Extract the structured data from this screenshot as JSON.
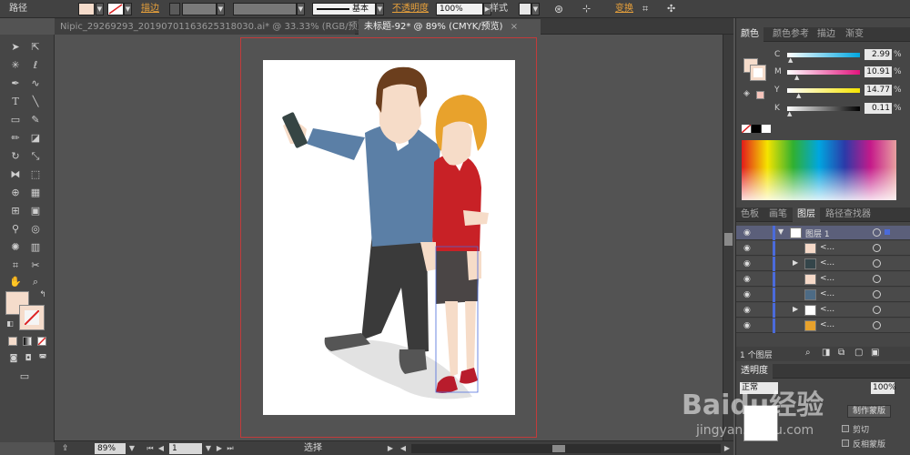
{
  "control_bar": {
    "object_type": "路径",
    "stroke_label": "描边",
    "stroke_style": "基本",
    "opacity_label": "不透明度",
    "opacity_value": "100%",
    "style_label": "样式",
    "transform_label": "变换"
  },
  "tabs": [
    {
      "label": "Nipic_29269293_20190701163625318030.ai* @ 33.33% (RGB/预览)",
      "active": false
    },
    {
      "label": "未标题-92* @ 89% (CMYK/预览)",
      "active": true
    }
  ],
  "tab_close": "×",
  "status": {
    "zoom": "89%",
    "artboard": "1",
    "tool": "选择"
  },
  "color_panel": {
    "tabs": [
      "颜色",
      "颜色参考",
      "描边",
      "渐变"
    ],
    "sliders": [
      {
        "label": "C",
        "value": "2.99",
        "unit": "%",
        "pos": 0.03
      },
      {
        "label": "M",
        "value": "10.91",
        "unit": "%",
        "pos": 0.11
      },
      {
        "label": "Y",
        "value": "14.77",
        "unit": "%",
        "pos": 0.15
      },
      {
        "label": "K",
        "value": "0.11",
        "unit": "%",
        "pos": 0.01
      }
    ]
  },
  "layers_panel": {
    "tabs": [
      "色板",
      "画笔",
      "图层",
      "路径查找器"
    ],
    "layer_name": "图层 1",
    "sublayer_label": "<...",
    "count_label": "1 个图层"
  },
  "transparency_panel": {
    "tab": "透明度",
    "blend_mode": "正常",
    "opacity": "100%",
    "make_mask": "制作蒙版",
    "clip_label": "剪切",
    "invert_label": "反相蒙版"
  },
  "watermark": {
    "text1": "Baidu经验",
    "text2": "jingyan.baidu.com"
  },
  "colors": {
    "fill": "#f5dccb",
    "skin": "#f6dcc8",
    "man_hair": "#6b3e1d",
    "man_sweater": "#5b7fa6",
    "man_pants": "#3a3a3a",
    "woman_hair": "#e8a22c",
    "woman_top": "#c82126",
    "woman_skirt": "#4a4545",
    "shoes": "#b81c2c"
  }
}
